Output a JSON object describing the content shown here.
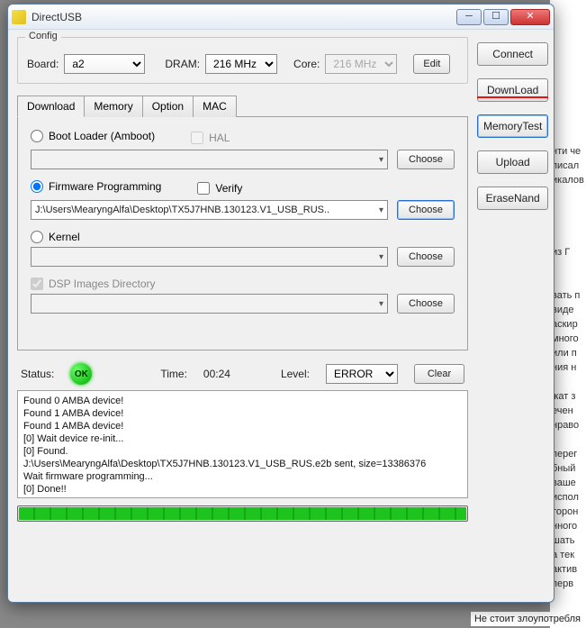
{
  "window": {
    "title": "DirectUSB"
  },
  "config": {
    "group_label": "Config",
    "board_label": "Board:",
    "board_value": "a2",
    "dram_label": "DRAM:",
    "dram_value": "216 MHz",
    "core_label": "Core:",
    "core_value": "216 MHz",
    "edit_label": "Edit"
  },
  "tabs": {
    "items": [
      "Download",
      "Memory",
      "Option",
      "MAC"
    ],
    "active": 0
  },
  "download": {
    "bootloader_label": "Boot Loader (Amboot)",
    "hal_label": "HAL",
    "firmware_label": "Firmware Programming",
    "verify_label": "Verify",
    "firmware_path": "J:\\Users\\MearyngAlfa\\Desktop\\TX5J7HNB.130123.V1_USB_RUS..",
    "kernel_label": "Kernel",
    "dsp_label": "DSP Images Directory",
    "choose_label": "Choose",
    "selected": "firmware",
    "verify_checked": false,
    "hal_checked": false,
    "dsp_checked": true
  },
  "status": {
    "status_label": "Status:",
    "status_value": "OK",
    "time_label": "Time:",
    "time_value": "00:24",
    "level_label": "Level:",
    "level_value": "ERROR",
    "clear_label": "Clear"
  },
  "log": {
    "lines": [
      "Found 0 AMBA device!",
      "Found 1 AMBA device!",
      "Found 1 AMBA device!",
      "[0] Wait device re-init...",
      "[0] Found.",
      "J:\\Users\\MearyngAlfa\\Desktop\\TX5J7HNB.130123.V1_USB_RUS.e2b sent, size=13386376",
      "Wait firmware programming...",
      "[0] Done!!"
    ]
  },
  "progress": {
    "percent": 100
  },
  "sidebar": {
    "connect": "Connect",
    "download": "DownLoad",
    "memorytest": "MemoryTest",
    "upload": "Upload",
    "erasenand": "EraseNand"
  },
  "bg_text": "Не стоит злоупотребля"
}
